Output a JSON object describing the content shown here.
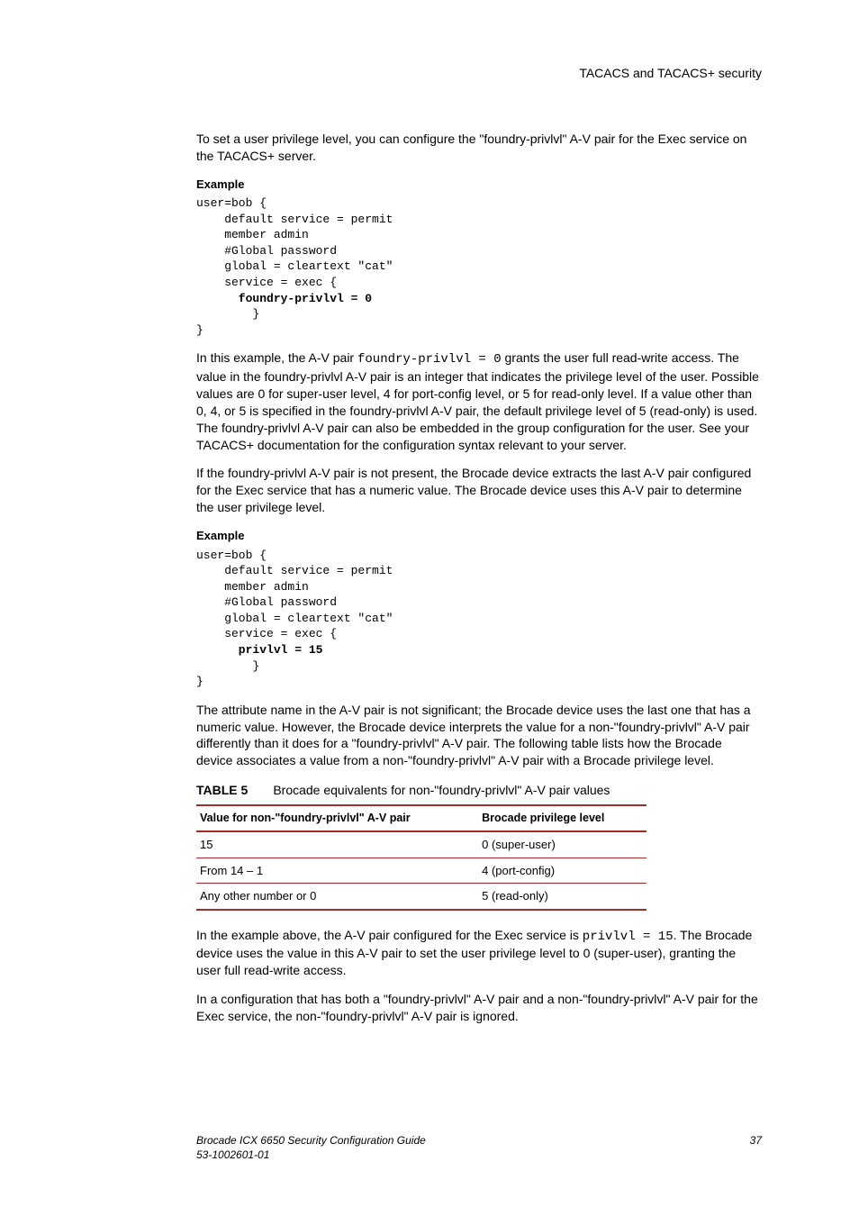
{
  "header": {
    "section": "TACACS and TACACS+ security"
  },
  "intro": "To set a user privilege level, you can configure the \"foundry-privlvl\" A-V pair for the Exec service on the TACACS+ server.",
  "example1": {
    "label": "Example",
    "l1": "user=bob {",
    "l2": "    default service = permit",
    "l3": "    member admin",
    "l4": "    #Global password",
    "l5": "    global = cleartext \"cat\"",
    "l6": "    service = exec {",
    "l7": "      foundry-privlvl = 0",
    "l8": "        }",
    "l9": "}"
  },
  "para_after_ex1_a": "In this example, the A-V pair ",
  "para_after_ex1_code": "foundry-privlvl = 0",
  "para_after_ex1_b": " grants the user full read-write access. The value in the foundry-privlvl A-V pair is an integer that indicates the privilege level of the user. Possible values are 0 for super-user level, 4 for port-config level, or 5 for read-only level. If a value other than 0, 4, or 5 is specified in the foundry-privlvl A-V pair, the default privilege level of 5 (read-only) is used. The foundry-privlvl A-V pair can also be embedded in the group configuration for the user. See your TACACS+ documentation for the configuration syntax relevant to your server.",
  "para2": "If the foundry-privlvl A-V pair is not present, the Brocade device extracts the last A-V pair configured for the Exec service that has a numeric value. The Brocade device uses this A-V pair to determine the user privilege level.",
  "example2": {
    "label": "Example",
    "l1": "user=bob {",
    "l2": "    default service = permit",
    "l3": "    member admin",
    "l4": "    #Global password",
    "l5": "    global = cleartext \"cat\"",
    "l6": "    service = exec {",
    "l7": "      privlvl = 15",
    "l8": "        }",
    "l9": "}"
  },
  "para3": "The attribute name in the A-V pair is not significant; the Brocade device uses the last one that has a numeric value. However, the Brocade device interprets the value for a non-\"foundry-privlvl\" A-V pair differently than it does for a \"foundry-privlvl\" A-V pair. The following table lists how the Brocade device associates a value from a non-\"foundry-privlvl\" A-V pair with a Brocade privilege level.",
  "table": {
    "label": "TABLE 5",
    "caption": "Brocade equivalents for non-\"foundry-privlvl\" A-V pair values",
    "headers": {
      "col1": "Value for non-\"foundry-privlvl\" A-V pair",
      "col2": "Brocade privilege level"
    },
    "rows": [
      {
        "c1": "15",
        "c2": "0 (super-user)"
      },
      {
        "c1": "From 14 – 1",
        "c2": "4 (port-config)"
      },
      {
        "c1": "Any other number or 0",
        "c2": "5 (read-only)"
      }
    ]
  },
  "para4_a": "In the example above, the A-V pair configured for the Exec service is ",
  "para4_code": "privlvl = 15",
  "para4_b": ". The Brocade device uses the value in this A-V pair to set the user privilege level to 0 (super-user), granting the user full read-write access.",
  "para5": "In a configuration that has both a \"foundry-privlvl\" A-V pair and a non-\"foundry-privlvl\" A-V pair for the Exec service, the non-\"foundry-privlvl\" A-V pair is ignored.",
  "footer": {
    "guide": "Brocade ICX 6650 Security Configuration Guide",
    "docnum": "53-1002601-01",
    "page": "37"
  }
}
